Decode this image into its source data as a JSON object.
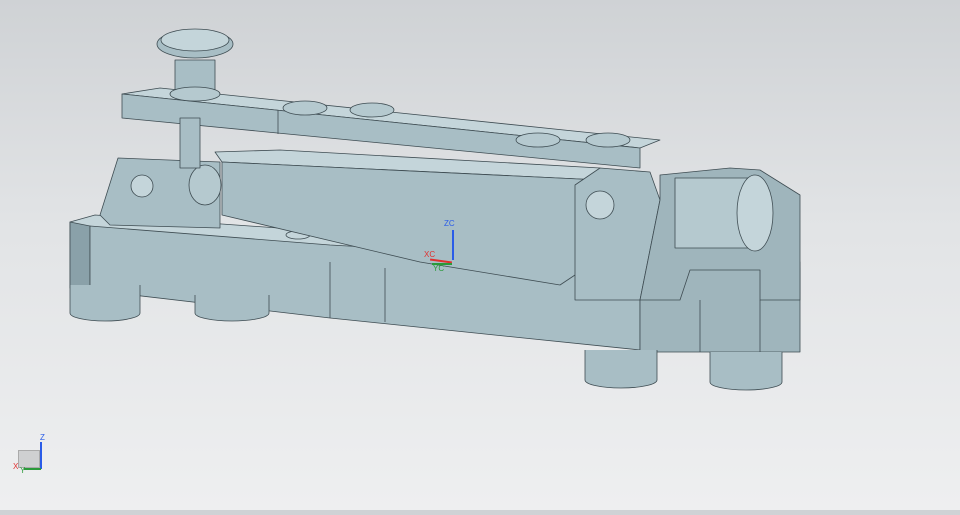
{
  "viewport": {
    "wcs_labels": {
      "z": "ZC",
      "x": "XC",
      "y": "YC"
    },
    "triad_labels": {
      "z": "Z",
      "x": "X",
      "y": "Y"
    }
  },
  "colors": {
    "model": "#a8bec5",
    "model_dark": "#8aa1a9",
    "model_light": "#c4d5da",
    "edge": "#3e4c52",
    "axis_x": "#e03030",
    "axis_y": "#2a9a3a",
    "axis_z": "#2a5ce8"
  }
}
